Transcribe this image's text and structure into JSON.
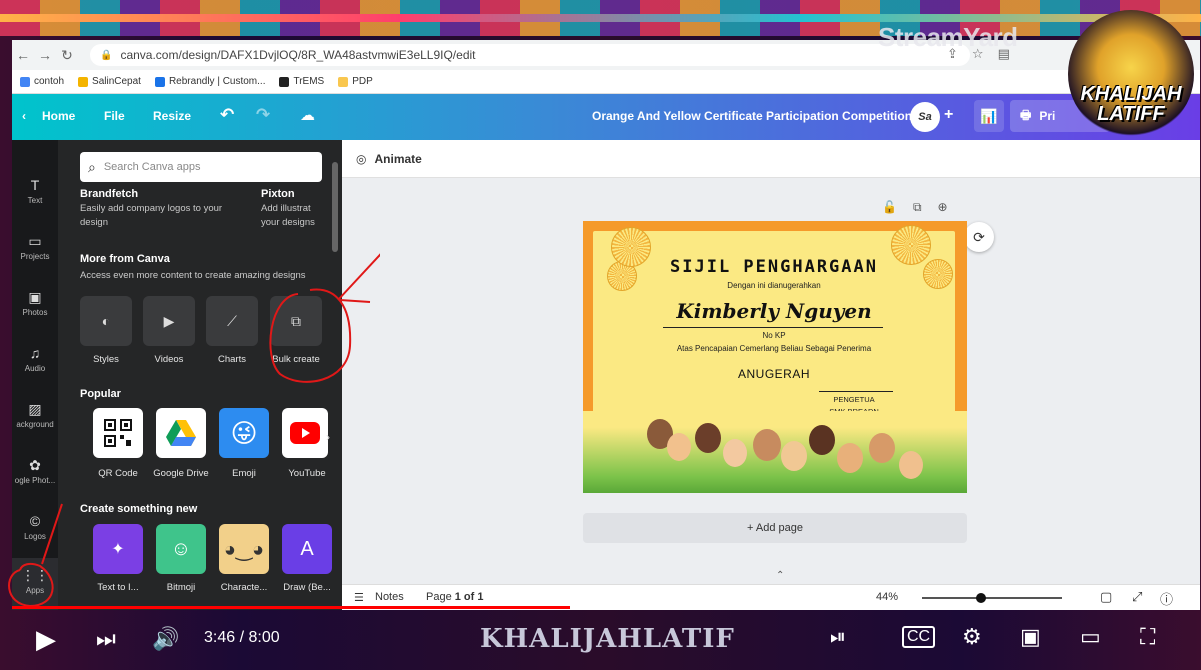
{
  "overlay": {
    "streamyard": "StreamYard",
    "logo_text": "KHALIJAH LATIFF"
  },
  "browser": {
    "url": "canva.com/design/DAFX1DvjlOQ/8R_WA48astvmwiE3eLL9IQ/edit",
    "bookmarks": [
      {
        "label": "contoh",
        "color": "#4285f4"
      },
      {
        "label": "SalinCepat",
        "color": "#f4b400"
      },
      {
        "label": "Rebrandly | Custom...",
        "color": "#1a73e8"
      },
      {
        "label": "TrEMS",
        "color": "#222222"
      },
      {
        "label": "PDP",
        "color": "#f9c74f"
      }
    ]
  },
  "canva": {
    "home": "Home",
    "file": "File",
    "resize": "Resize",
    "doc_title": "Orange And Yellow Certificate Participation Competition",
    "avatar": "Sa",
    "print": "Pri"
  },
  "rail": [
    {
      "label": "Text",
      "icon": "T"
    },
    {
      "label": "Projects",
      "icon": "▭"
    },
    {
      "label": "Photos",
      "icon": "▣"
    },
    {
      "label": "Audio",
      "icon": "♫"
    },
    {
      "label": "ackground",
      "icon": "▨"
    },
    {
      "label": "ogle Phot...",
      "icon": "✿"
    },
    {
      "label": "Logos",
      "icon": "©"
    },
    {
      "label": "Apps",
      "icon": "⋮⋮"
    }
  ],
  "panel": {
    "search_placeholder": "Search Canva apps",
    "brandfetch": {
      "name": "Brandfetch",
      "desc": "Easily add company logos to your design"
    },
    "pixton": {
      "name": "Pixton",
      "desc": "Add illustrat your designs"
    },
    "more_title": "More from Canva",
    "more_sub": "Access even more content to create amazing designs",
    "more_items": [
      "Styles",
      "Videos",
      "Charts",
      "Bulk create"
    ],
    "popular_title": "Popular",
    "popular_items": [
      "QR Code",
      "Google Drive",
      "Emoji",
      "YouTube"
    ],
    "create_title": "Create something new",
    "create_items": [
      "Text to I...",
      "Bitmoji",
      "Characte...",
      "Draw (Be..."
    ]
  },
  "editor": {
    "animate": "Animate",
    "add_page": "+ Add page",
    "notes": "Notes",
    "page_prefix": "Page ",
    "page_bold": "1 of 1",
    "zoom": "44%"
  },
  "certificate": {
    "title": "SIJIL PENGHARGAAN",
    "subtitle": "Dengan ini dianugerahkan",
    "name": "Kimberly Nguyen",
    "no_kp": "No KP",
    "reason": "Atas Pencapaian Cemerlang Beliau Sebagai Penerima",
    "award": "ANUGERAH",
    "sign_role": "PENGETUA",
    "sign_school": "SMK BREADN"
  },
  "player": {
    "time": "3:46 / 8:00",
    "channel": "KHALIJAHLATIF",
    "progress": 0.47
  }
}
